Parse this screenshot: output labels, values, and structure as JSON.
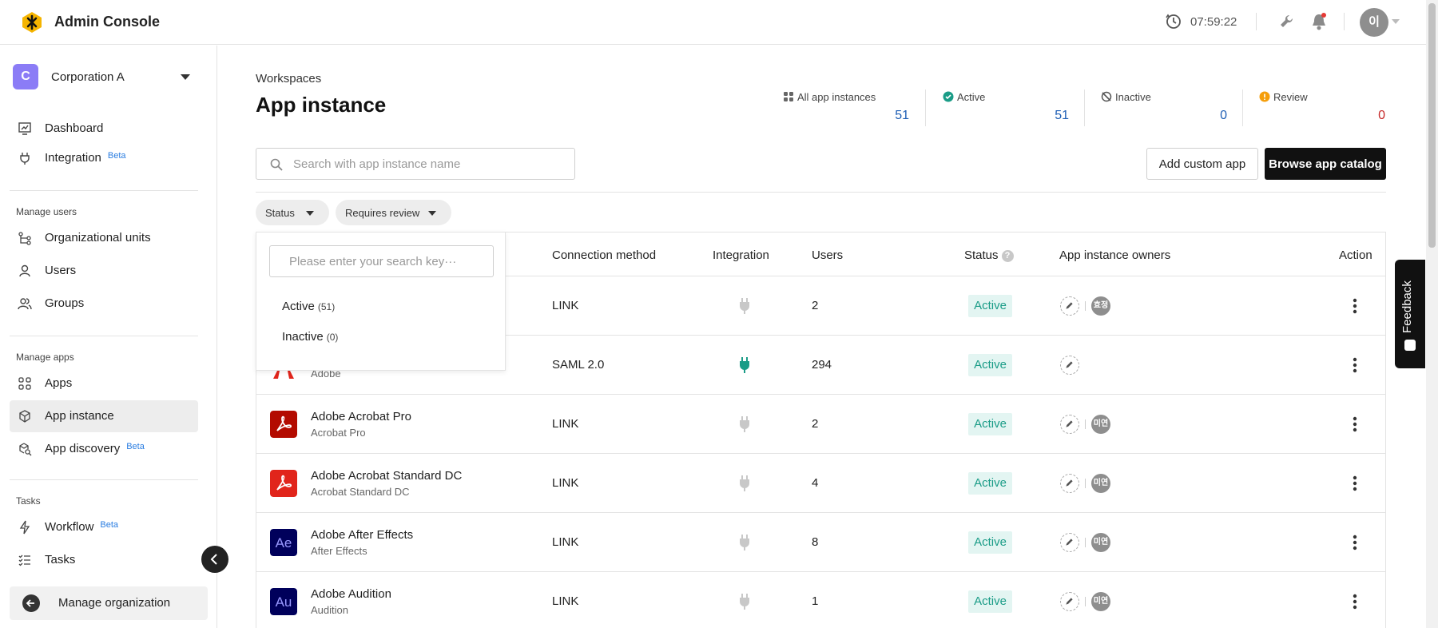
{
  "app": {
    "title": "Admin Console",
    "time": "07:59:22",
    "avatar_initials": "이"
  },
  "colors": {
    "accent": "#1f5fb5",
    "active_badge_bg": "#e3f5f2",
    "active_badge_text": "#1a9c87",
    "review": "#c62828",
    "org_badge": "#8b7cf6"
  },
  "sidebar": {
    "org": {
      "initial": "C",
      "name": "Corporation A"
    },
    "top_items": [
      {
        "label": "Dashboard",
        "icon": "dashboard-icon"
      },
      {
        "label": "Integration",
        "beta": "Beta",
        "icon": "plug-icon"
      }
    ],
    "section_users": "Manage users",
    "user_items": [
      {
        "label": "Organizational units",
        "icon": "org-units-icon"
      },
      {
        "label": "Users",
        "icon": "user-icon"
      },
      {
        "label": "Groups",
        "icon": "groups-icon"
      }
    ],
    "section_apps": "Manage apps",
    "app_items": [
      {
        "label": "Apps",
        "icon": "apps-grid-icon"
      },
      {
        "label": "App instance",
        "icon": "cube-icon"
      },
      {
        "label": "App discovery",
        "beta": "Beta",
        "icon": "discovery-icon"
      }
    ],
    "section_tasks": "Tasks",
    "task_items": [
      {
        "label": "Workflow",
        "beta": "Beta",
        "icon": "workflow-icon"
      },
      {
        "label": "Tasks",
        "icon": "tasks-icon"
      }
    ],
    "manage_org": "Manage organization"
  },
  "main": {
    "breadcrumb": "Workspaces",
    "title": "App instance",
    "stats": [
      {
        "label": "All app instances",
        "value": "51",
        "icon": "grid-icon"
      },
      {
        "label": "Active",
        "value": "51",
        "icon": "check-circle-icon"
      },
      {
        "label": "Inactive",
        "value": "0",
        "icon": "inactive-icon"
      },
      {
        "label": "Review",
        "value": "0",
        "icon": "warning-icon"
      }
    ],
    "search_placeholder": "Search with app instance name",
    "add_custom_app": "Add custom app",
    "browse_catalog": "Browse app catalog",
    "filters": {
      "status": "Status",
      "requires_review": "Requires review"
    },
    "dropdown": {
      "placeholder": "Please enter your search key···",
      "options": [
        {
          "label": "Active",
          "count": "(51)"
        },
        {
          "label": "Inactive",
          "count": "(0)"
        }
      ]
    },
    "table": {
      "headers": {
        "connection": "Connection method",
        "integration": "Integration",
        "users": "Users",
        "status": "Status",
        "status_help": "?",
        "owners": "App instance owners",
        "action": "Action"
      },
      "rows": [
        {
          "name": "",
          "sub": "",
          "connection": "LINK",
          "integrated": false,
          "users": "2",
          "status": "Active",
          "owner": "효정"
        },
        {
          "name": "",
          "sub": "Adobe",
          "connection": "SAML 2.0",
          "integrated": true,
          "users": "294",
          "status": "Active",
          "owner": ""
        },
        {
          "name": "Adobe Acrobat Pro",
          "sub": "Acrobat Pro",
          "connection": "LINK",
          "integrated": false,
          "users": "2",
          "status": "Active",
          "owner": "미연",
          "logo": "acrobat"
        },
        {
          "name": "Adobe Acrobat Standard DC",
          "sub": "Acrobat Standard DC",
          "connection": "LINK",
          "integrated": false,
          "users": "4",
          "status": "Active",
          "owner": "미연",
          "logo": "acrobat"
        },
        {
          "name": "Adobe After Effects",
          "sub": "After Effects",
          "connection": "LINK",
          "integrated": false,
          "users": "8",
          "status": "Active",
          "owner": "미연",
          "logo": "Ae"
        },
        {
          "name": "Adobe Audition",
          "sub": "Audition",
          "connection": "LINK",
          "integrated": false,
          "users": "1",
          "status": "Active",
          "owner": "미연",
          "logo": "Au"
        }
      ]
    }
  },
  "feedback": "Feedback"
}
